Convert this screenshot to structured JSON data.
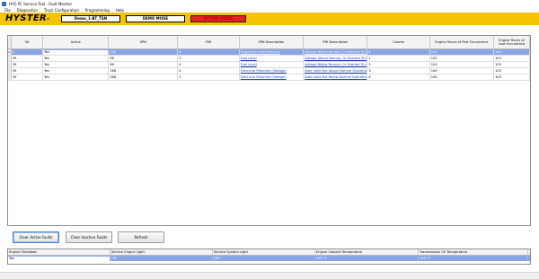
{
  "window": {
    "title": "HYG PC Service Tool - Fault Monitor"
  },
  "menu": [
    "File",
    "Diagnostics",
    "Truck Configuration",
    "Programming",
    "Help"
  ],
  "header": {
    "logo_text": "HYSTER",
    "session": "Demo_1-BT_TSN",
    "mode": "DEMO MODE",
    "active_codes": "ACTIVE CODES",
    "brand_color": "#f5c400",
    "alert_color": "#e62222"
  },
  "faults": {
    "columns": [
      "SA",
      "Active",
      "SPN",
      "FMI",
      "SPN Description",
      "FMI Description",
      "Counts",
      "Engine Hours of First Occurrence",
      "Engine Hours of Last Occurrence"
    ],
    "rows": [
      {
        "sa": "0",
        "active": "Yes",
        "spn": "100",
        "fmi": "4",
        "spn_desc": "Engine Air Inlet Pressure",
        "fmi_desc": "Voltage Below Normal, Or Shorted To Lo...",
        "counts": "6",
        "first": "101",
        "last": "103"
      },
      {
        "sa": "39",
        "active": "Yes",
        "spn": "96",
        "fmi": "3",
        "spn_desc": "Fuel Level",
        "fmi_desc": "Voltage Above Normal, Or Shorted To Hi...",
        "counts": "1",
        "first": "102",
        "last": "103"
      },
      {
        "sa": "39",
        "active": "Yes",
        "spn": "96",
        "fmi": "4",
        "spn_desc": "Fuel Level",
        "fmi_desc": "Voltage Below Normal, Or Shorted To Lo...",
        "counts": "2",
        "first": "103",
        "last": "103"
      },
      {
        "sa": "39",
        "active": "Yes",
        "spn": "168",
        "fmi": "0",
        "spn_desc": "Electrical Potential (Voltage)",
        "fmi_desc": "Data Valid But Above Normal Operational...",
        "counts": "3",
        "first": "104",
        "last": "103"
      },
      {
        "sa": "39",
        "active": "Yes",
        "spn": "168",
        "fmi": "1",
        "spn_desc": "Electrical Potential (Voltage)",
        "fmi_desc": "Data Valid But Below Normal Operational...",
        "counts": "4",
        "first": "105",
        "last": "103"
      }
    ]
  },
  "buttons": {
    "clear_active": "Clear Active Faults",
    "clear_inactive": "Clear Inactive Faults",
    "refresh": "Refresh"
  },
  "status_panel": {
    "columns": [
      "Engine Shutdown",
      "Service Engine Light",
      "Service System Light",
      "Engine Coolant Temperature",
      "Transmission Oil Temperature"
    ],
    "values": [
      "Yes",
      "ON",
      "OFF",
      "150 °C",
      "150 °C"
    ]
  }
}
